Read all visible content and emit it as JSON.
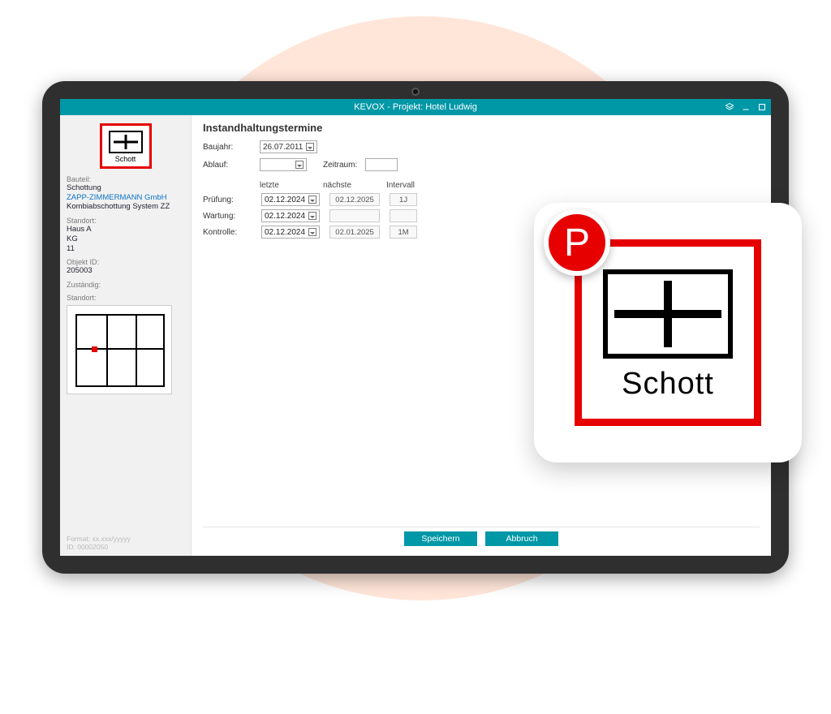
{
  "titlebar": {
    "title": "KEVOX - Projekt: Hotel Ludwig"
  },
  "sidebar": {
    "symbol_label": "Schott",
    "bauteil_label": "Bauteil:",
    "bauteil_line1": "Schottung",
    "bauteil_line2": "ZAPP-ZIMMERMANN GmbH",
    "bauteil_line3": "Kombiabschottung System ZZ",
    "standort_label": "Standort:",
    "standort_line1": "Haus A",
    "standort_line2": "KG",
    "standort_line3": "11",
    "objektid_label": "Objekt ID:",
    "objektid_value": "205003",
    "zustaendig_label": "Zuständig:",
    "standort2_label": "Standort:",
    "format_hint": "Format: xx.xxx/yyyyy",
    "id_hint": "ID: 00002050"
  },
  "main": {
    "heading": "Instandhaltungstermine",
    "baujahr_label": "Baujahr:",
    "baujahr_value": "26.07.2011",
    "ablauf_label": "Ablauf:",
    "zeitraum_label": "Zeitraum:",
    "col_letzte": "letzte",
    "col_naechste": "nächste",
    "col_intervall": "Intervall",
    "pruefung": {
      "label": "Prüfung:",
      "letzte": "02.12.2024",
      "naechste": "02.12.2025",
      "intervall": "1J"
    },
    "wartung": {
      "label": "Wartung:",
      "letzte": "02.12.2024",
      "naechste": "",
      "intervall": ""
    },
    "kontrolle": {
      "label": "Kontrolle:",
      "letzte": "02.12.2024",
      "naechste": "02.01.2025",
      "intervall": "1M"
    }
  },
  "footer": {
    "save": "Speichern",
    "cancel": "Abbruch"
  },
  "overlay": {
    "symbol_label": "Schott",
    "badge": "P"
  }
}
